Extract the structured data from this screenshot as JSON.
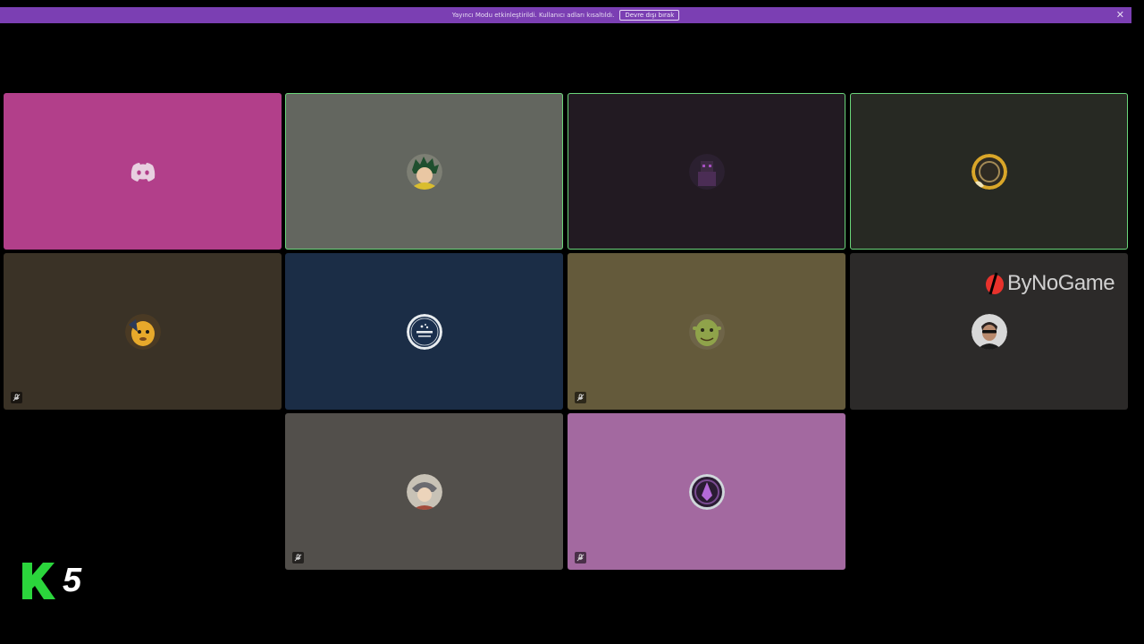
{
  "banner": {
    "message": "Yayıncı Modu etkinleştirildi. Kullanıcı adları kısaltıldı.",
    "button_label": "Devre dışı bırak",
    "close_icon": "close-icon",
    "color": "#7b3fb3"
  },
  "tiles": [
    {
      "name": "tile-discord-default",
      "bg": "#b23f8a",
      "speaking": false,
      "muted": false,
      "avatar_icon": "discord-logo-icon"
    },
    {
      "name": "tile-green-hair-avatar",
      "bg": "#63665f",
      "speaking": true,
      "muted": false,
      "avatar_icon": "green-hair-character-avatar"
    },
    {
      "name": "tile-purple-figure-avatar",
      "bg": "#221a22",
      "speaking": true,
      "muted": false,
      "avatar_icon": "purple-figure-avatar"
    },
    {
      "name": "tile-gold-emblem-avatar",
      "bg": "#272923",
      "speaking": true,
      "muted": false,
      "avatar_icon": "gold-emblem-avatar"
    },
    {
      "name": "tile-yellow-dog-avatar",
      "bg": "#3a3226",
      "speaking": false,
      "muted": true,
      "avatar_icon": "yellow-dog-avatar"
    },
    {
      "name": "tile-subaru-avatar",
      "bg": "#1b2d46",
      "speaking": false,
      "muted": false,
      "avatar_icon": "subaru-logo-avatar"
    },
    {
      "name": "tile-ogre-avatar",
      "bg": "#645a3b",
      "speaking": false,
      "muted": true,
      "avatar_icon": "green-ogre-avatar"
    },
    {
      "name": "tile-sunglasses-man-avatar",
      "bg": "#2c2a29",
      "speaking": false,
      "muted": false,
      "avatar_icon": "sunglasses-man-avatar"
    },
    {
      "name": "tile-sketch-avatar",
      "bg": "#524f4b",
      "speaking": false,
      "muted": true,
      "avatar_icon": "sketch-character-avatar"
    },
    {
      "name": "tile-purple-emblem-avatar",
      "bg": "#a369a0",
      "speaking": false,
      "muted": true,
      "avatar_icon": "purple-emblem-avatar"
    }
  ],
  "watermarks": {
    "bynogame": "ByNoGame",
    "k5": "5",
    "k5_color": "#2bd53c"
  }
}
